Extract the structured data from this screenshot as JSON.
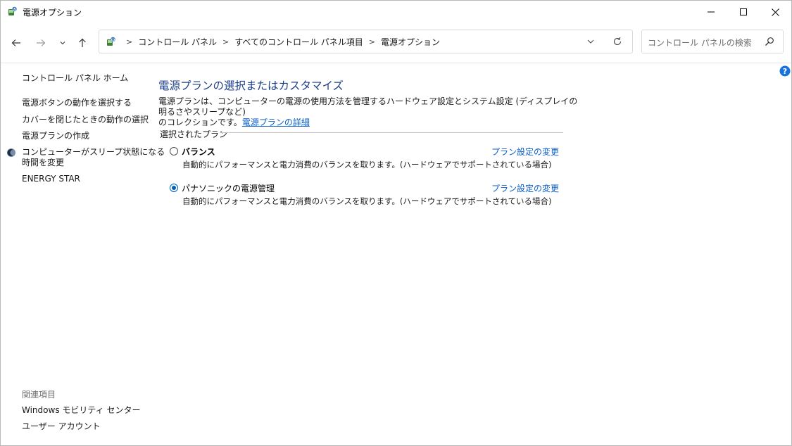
{
  "window": {
    "title": "電源オプション"
  },
  "address": {
    "crumbs": [
      "コントロール パネル",
      "すべてのコントロール パネル項目",
      "電源オプション"
    ]
  },
  "search": {
    "placeholder": "コントロール パネルの検索"
  },
  "sidebar": {
    "home": "コントロール パネル ホーム",
    "links": [
      "電源ボタンの動作を選択する",
      "カバーを閉じたときの動作の選択",
      "電源プランの作成",
      "コンピューターがスリープ状態になる",
      "時間を変更",
      "ENERGY STAR"
    ],
    "related_title": "関連項目",
    "related": [
      "Windows モビリティ センター",
      "ユーザー アカウント"
    ]
  },
  "main": {
    "title": "電源プランの選択またはカスタマイズ",
    "desc_line1": "電源プランは、コンピューターの電源の使用方法を管理するハードウェア設定とシステム設定 (ディスプレイの明るさやスリープなど)",
    "desc_line2": "のコレクションです。",
    "desc_link": "電源プランの詳細",
    "section_label": "選択されたプラン",
    "plans": [
      {
        "name": "バランス",
        "selected": false,
        "link": "プラン設定の変更",
        "desc": "自動的にパフォーマンスと電力消費のバランスを取ります。(ハードウェアでサポートされている場合)"
      },
      {
        "name": "パナソニックの電源管理",
        "selected": true,
        "link": "プラン設定の変更",
        "desc": "自動的にパフォーマンスと電力消費のバランスを取ります。(ハードウェアでサポートされている場合)"
      }
    ]
  },
  "colors": {
    "title_blue": "#1e3f8a",
    "link_blue": "#0a5ec7",
    "radio_blue": "#005fb8",
    "help_blue": "#1a73d9"
  },
  "icons": [
    "power-options-icon",
    "minimize-icon",
    "maximize-icon",
    "close-icon",
    "back-arrow-icon",
    "forward-arrow-icon",
    "recent-chevron-icon",
    "up-arrow-icon",
    "chevron-down-icon",
    "refresh-icon",
    "search-icon",
    "shield-icon",
    "help-icon"
  ]
}
